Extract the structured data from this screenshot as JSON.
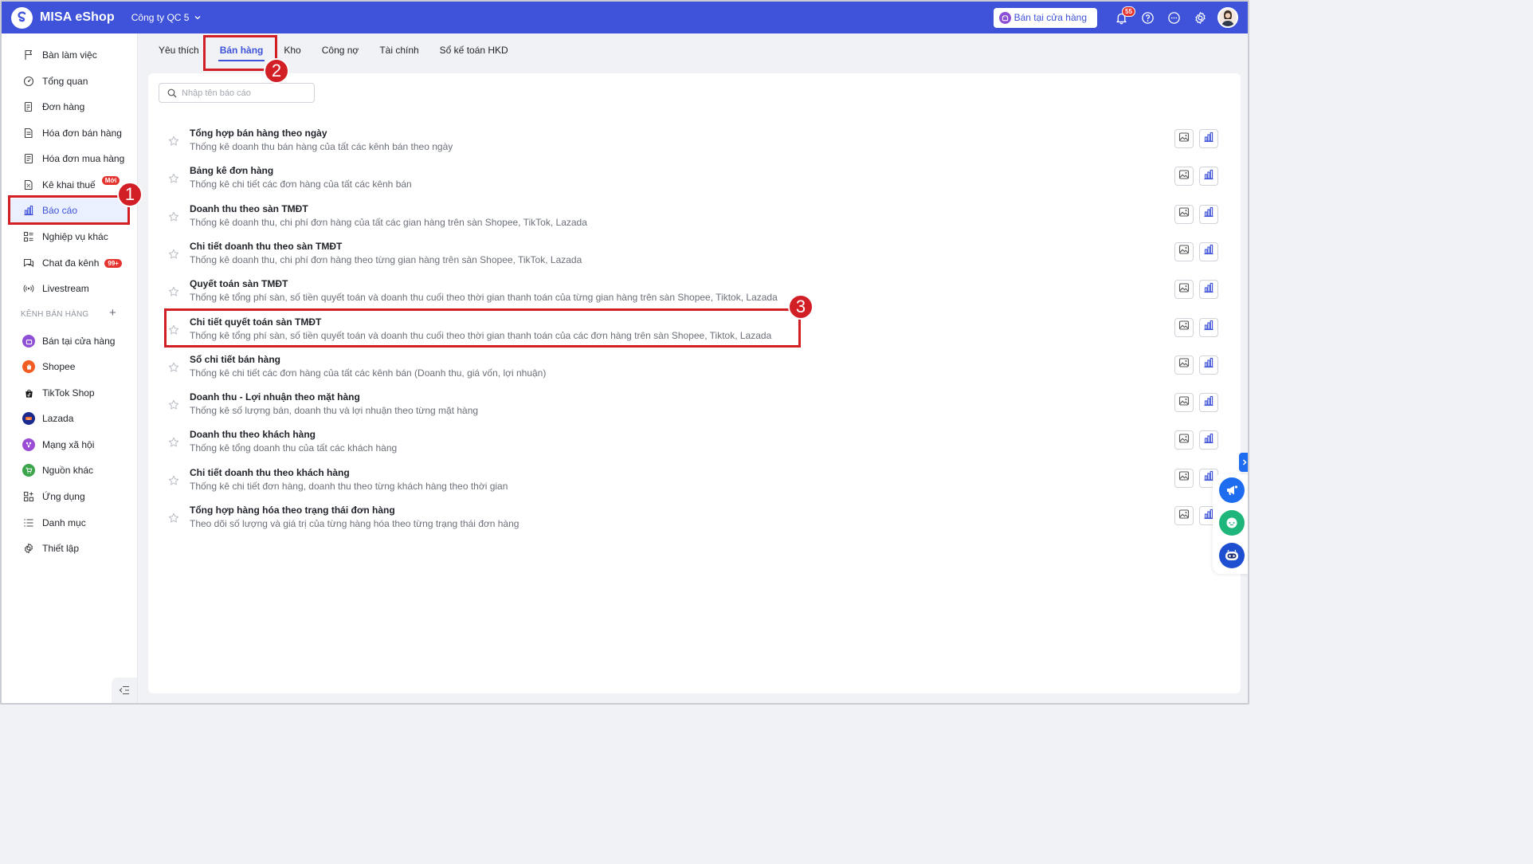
{
  "header": {
    "app_name": "MISA eShop",
    "company": "Công ty QC 5",
    "store_button": "Bán tại cửa hàng",
    "notification_count": "55",
    "accent_color": "#3e53d9"
  },
  "sidebar": {
    "items": [
      {
        "label": "Bàn làm việc",
        "icon": "flag-icon"
      },
      {
        "label": "Tổng quan",
        "icon": "dashboard-icon"
      },
      {
        "label": "Đơn hàng",
        "icon": "order-icon"
      },
      {
        "label": "Hóa đơn bán hàng",
        "icon": "invoice-icon"
      },
      {
        "label": "Hóa đơn mua hàng",
        "icon": "purchase-invoice-icon"
      },
      {
        "label": "Kê khai thuế",
        "icon": "tax-icon",
        "badge": "Mới"
      },
      {
        "label": "Báo cáo",
        "icon": "chart-icon",
        "active": true
      },
      {
        "label": "Nghiệp vụ khác",
        "icon": "grid-list-icon"
      },
      {
        "label": "Chat đa kênh",
        "icon": "chat-icon",
        "badge": "99+"
      },
      {
        "label": "Livestream",
        "icon": "broadcast-icon"
      }
    ],
    "channels_title": "KÊNH BÁN HÀNG",
    "channels": [
      {
        "label": "Bán tại cửa hàng",
        "icon": "store-icon",
        "color": "#8c4fd6"
      },
      {
        "label": "Shopee",
        "icon": "shopee-icon",
        "color": "#f05d23"
      },
      {
        "label": "TikTok Shop",
        "icon": "tiktok-icon",
        "color": "#111111"
      },
      {
        "label": "Lazada",
        "icon": "lazada-icon",
        "color": "#1b2a8f"
      },
      {
        "label": "Mạng xã hội",
        "icon": "social-icon",
        "color": "#9b4dd6"
      },
      {
        "label": "Nguồn khác",
        "icon": "other-source-icon",
        "color": "#3aa54a"
      }
    ],
    "bottom_items": [
      {
        "label": "Ứng dụng",
        "icon": "apps-icon"
      },
      {
        "label": "Danh mục",
        "icon": "list-icon"
      },
      {
        "label": "Thiết lập",
        "icon": "settings-icon"
      }
    ]
  },
  "tabs": [
    {
      "label": "Yêu thích"
    },
    {
      "label": "Bán hàng",
      "active": true
    },
    {
      "label": "Kho"
    },
    {
      "label": "Công nợ"
    },
    {
      "label": "Tài chính"
    },
    {
      "label": "Sổ kế toán HKD"
    }
  ],
  "search": {
    "placeholder": "Nhập tên báo cáo"
  },
  "reports": [
    {
      "title": "Tổng hợp bán hàng theo ngày",
      "desc": "Thống kê doanh thu bán hàng của tất các kênh bán theo ngày"
    },
    {
      "title": "Bảng kê đơn hàng",
      "desc": "Thống kê chi tiết các đơn hàng của tất các kênh bán"
    },
    {
      "title": "Doanh thu theo sàn TMĐT",
      "desc": "Thống kê doanh thu, chi phí đơn hàng của tất các gian hàng trên sàn Shopee, TikTok, Lazada"
    },
    {
      "title": "Chi tiết doanh thu theo sàn TMĐT",
      "desc": "Thống kê doanh thu, chi phí đơn hàng theo từng gian hàng trên sàn Shopee, TikTok, Lazada"
    },
    {
      "title": "Quyết toán sàn TMĐT",
      "desc": "Thống kê tổng phí sàn, số tiền quyết toán và doanh thu cuối theo thời gian thanh toán của từng gian hàng trên sàn Shopee, Tiktok, Lazada"
    },
    {
      "title": "Chi tiết quyết toán sàn TMĐT",
      "desc": "Thống kê tổng phí sàn, số tiền quyết toán và doanh thu cuối theo thời gian thanh toán của các đơn hàng trên sàn Shopee, Tiktok, Lazada"
    },
    {
      "title": "Sổ chi tiết bán hàng",
      "desc": "Thống kê chi tiết các đơn hàng của tất các kênh bán (Doanh thu, giá vốn, lợi nhuận)"
    },
    {
      "title": "Doanh thu - Lợi nhuận theo mặt hàng",
      "desc": "Thống kê số lượng bán, doanh thu và lợi nhuận theo từng mặt hàng"
    },
    {
      "title": "Doanh thu theo khách hàng",
      "desc": "Thống kê tổng doanh thu của tất các khách hàng"
    },
    {
      "title": "Chi tiết doanh thu theo khách hàng",
      "desc": "Thống kê chi tiết đơn hàng, doanh thu theo từng khách hàng theo thời gian"
    },
    {
      "title": "Tổng hợp hàng hóa theo trạng thái đơn hàng",
      "desc": "Theo dõi số lượng và giá trị của từng hàng hóa theo từng trạng thái đơn hàng"
    }
  ],
  "annotations": [
    "1",
    "2",
    "3"
  ]
}
